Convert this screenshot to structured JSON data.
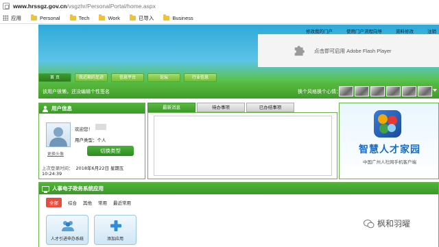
{
  "browser": {
    "url_host": "www.hrssgz.gov.cn",
    "url_path": "/vsgzhr/PersonalPortal/home.aspx",
    "bookmarks": [
      {
        "label": "应用",
        "icon": "apps-grid-icon"
      },
      {
        "label": "Personal",
        "icon": "folder-icon"
      },
      {
        "label": "Tech",
        "icon": "folder-icon"
      },
      {
        "label": "Work",
        "icon": "folder-icon"
      },
      {
        "label": "已导入",
        "icon": "folder-icon"
      },
      {
        "label": "Business",
        "icon": "folder-icon"
      }
    ]
  },
  "header": {
    "top_links": [
      "修改我的门户",
      "使用门户流程向导",
      "资料修改",
      "注销"
    ],
    "flash_prompt": "点击即可启用 Adobe Flash Player",
    "tabs": [
      "首 页",
      "我近期的足迹",
      "信息平台",
      "论坛",
      "行业信息"
    ]
  },
  "strip": {
    "welcome": "该用户很懒，还没编辑个性签名",
    "skin_label": "换个风格换个心情："
  },
  "user_panel": {
    "title": "用户信息",
    "change_avatar": "更换头像",
    "welcome": "欢迎您！",
    "user_type_label": "用户类型：",
    "user_type_value": "个人",
    "switch_button": "切换类型",
    "last_login_label": "上次登录时间：",
    "last_login_value": "2018年6月22日 星期五 10:24:39"
  },
  "messages": {
    "tabs": [
      "最新消息",
      "待办事项",
      "已办结事项"
    ],
    "active_tab": "最新消息"
  },
  "promo": {
    "title": "智慧人才家园",
    "subtitle": "中国广州人社网手机客户端"
  },
  "eapps": {
    "title": "人事电子政务系统应用",
    "categories": [
      "全部",
      "综合",
      "其他",
      "常用",
      "最近常用"
    ],
    "tiles": [
      "人才引进申办系统",
      "添加应用"
    ]
  },
  "watermark": "枫和羽曜",
  "colors": {
    "green": "#3f9b2a",
    "blue_banner": "#2ea9d9",
    "active_category": "#e84c3d",
    "promo_title": "#1a6cc2"
  }
}
